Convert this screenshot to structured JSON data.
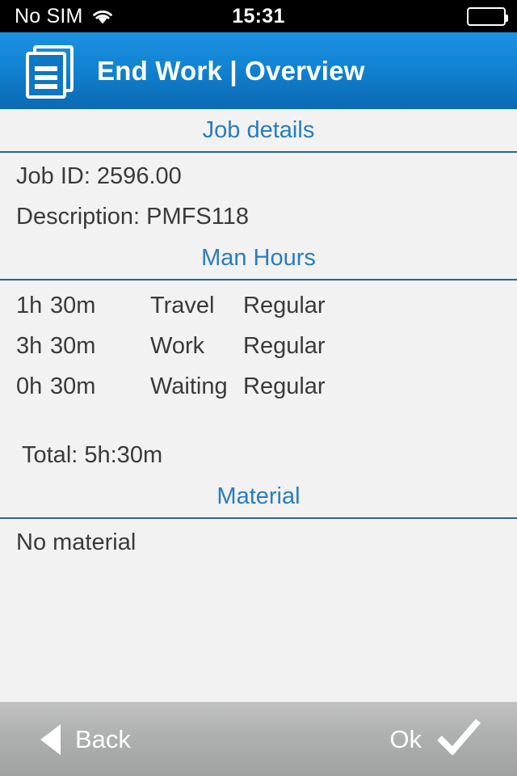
{
  "statusbar": {
    "carrier": "No SIM",
    "time": "15:31",
    "wifi_icon": "wifi-icon",
    "battery_icon": "battery-full-icon"
  },
  "header": {
    "title": "End Work | Overview",
    "icon": "documents-stack-icon"
  },
  "sections": {
    "job_details": {
      "title": "Job details",
      "job_id_label": "Job ID: 2596.00",
      "description_label": "Description: PMFS118"
    },
    "man_hours": {
      "title": "Man Hours",
      "rows": [
        {
          "hours": "1h",
          "minutes": "30m",
          "activity": "Travel",
          "rate": "Regular"
        },
        {
          "hours": "3h",
          "minutes": "30m",
          "activity": "Work",
          "rate": "Regular"
        },
        {
          "hours": "0h",
          "minutes": "30m",
          "activity": "Waiting",
          "rate": "Regular"
        }
      ],
      "total": "Total: 5h:30m"
    },
    "material": {
      "title": "Material",
      "empty_text": "No material"
    }
  },
  "toolbar": {
    "back_label": "Back",
    "back_icon": "triangle-left-icon",
    "ok_label": "Ok",
    "ok_icon": "checkmark-icon"
  },
  "colors": {
    "header_blue_top": "#1c91e2",
    "header_blue_bottom": "#0b69b2",
    "section_title_blue": "#2a7cbf",
    "rule_blue": "#2c6590",
    "content_bg": "#f2f2f2",
    "text_dark": "#3a3a3a",
    "toolbar_gray_top": "#c0c1c0",
    "toolbar_gray_bottom": "#9fa2a0"
  }
}
